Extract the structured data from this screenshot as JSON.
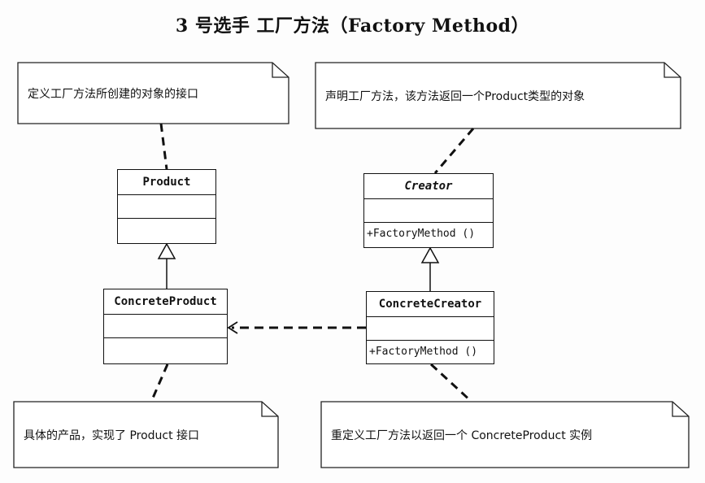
{
  "title": "3 号选手  工厂方法（Factory Method）",
  "notes": {
    "product_note": "定义工厂方法所创建的对象的接口",
    "creator_note": "声明工厂方法，该方法返回一个Product类型的对象",
    "concrete_product_note": "具体的产品，实现了 Product 接口",
    "concrete_creator_note": "重定义工厂方法以返回一个 ConcreteProduct 实例"
  },
  "classes": {
    "product": {
      "name": "Product"
    },
    "creator": {
      "name": "Creator",
      "operation": "+FactoryMethod ()"
    },
    "concrete_product": {
      "name": "ConcreteProduct"
    },
    "concrete_creator": {
      "name": "ConcreteCreator",
      "operation": "+FactoryMethod ()"
    }
  }
}
